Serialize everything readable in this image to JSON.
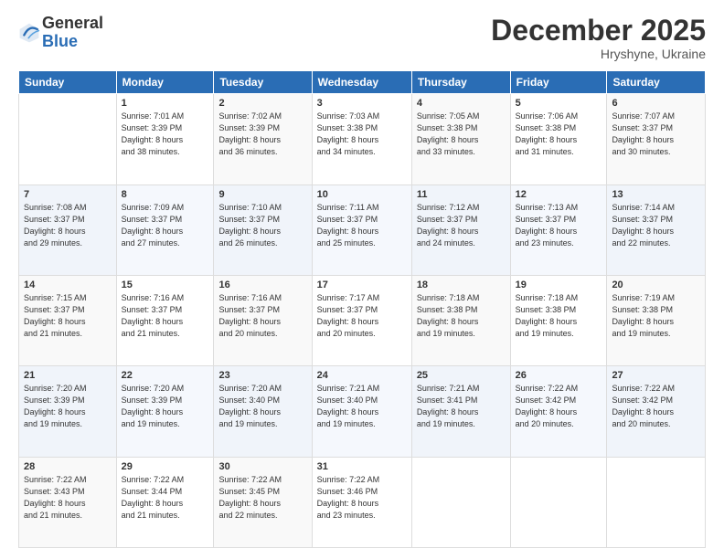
{
  "logo": {
    "general": "General",
    "blue": "Blue"
  },
  "title": {
    "month": "December 2025",
    "location": "Hryshyne, Ukraine"
  },
  "weekdays": [
    "Sunday",
    "Monday",
    "Tuesday",
    "Wednesday",
    "Thursday",
    "Friday",
    "Saturday"
  ],
  "weeks": [
    [
      {
        "day": "",
        "info": ""
      },
      {
        "day": "1",
        "info": "Sunrise: 7:01 AM\nSunset: 3:39 PM\nDaylight: 8 hours\nand 38 minutes."
      },
      {
        "day": "2",
        "info": "Sunrise: 7:02 AM\nSunset: 3:39 PM\nDaylight: 8 hours\nand 36 minutes."
      },
      {
        "day": "3",
        "info": "Sunrise: 7:03 AM\nSunset: 3:38 PM\nDaylight: 8 hours\nand 34 minutes."
      },
      {
        "day": "4",
        "info": "Sunrise: 7:05 AM\nSunset: 3:38 PM\nDaylight: 8 hours\nand 33 minutes."
      },
      {
        "day": "5",
        "info": "Sunrise: 7:06 AM\nSunset: 3:38 PM\nDaylight: 8 hours\nand 31 minutes."
      },
      {
        "day": "6",
        "info": "Sunrise: 7:07 AM\nSunset: 3:37 PM\nDaylight: 8 hours\nand 30 minutes."
      }
    ],
    [
      {
        "day": "7",
        "info": "Sunrise: 7:08 AM\nSunset: 3:37 PM\nDaylight: 8 hours\nand 29 minutes."
      },
      {
        "day": "8",
        "info": "Sunrise: 7:09 AM\nSunset: 3:37 PM\nDaylight: 8 hours\nand 27 minutes."
      },
      {
        "day": "9",
        "info": "Sunrise: 7:10 AM\nSunset: 3:37 PM\nDaylight: 8 hours\nand 26 minutes."
      },
      {
        "day": "10",
        "info": "Sunrise: 7:11 AM\nSunset: 3:37 PM\nDaylight: 8 hours\nand 25 minutes."
      },
      {
        "day": "11",
        "info": "Sunrise: 7:12 AM\nSunset: 3:37 PM\nDaylight: 8 hours\nand 24 minutes."
      },
      {
        "day": "12",
        "info": "Sunrise: 7:13 AM\nSunset: 3:37 PM\nDaylight: 8 hours\nand 23 minutes."
      },
      {
        "day": "13",
        "info": "Sunrise: 7:14 AM\nSunset: 3:37 PM\nDaylight: 8 hours\nand 22 minutes."
      }
    ],
    [
      {
        "day": "14",
        "info": "Sunrise: 7:15 AM\nSunset: 3:37 PM\nDaylight: 8 hours\nand 21 minutes."
      },
      {
        "day": "15",
        "info": "Sunrise: 7:16 AM\nSunset: 3:37 PM\nDaylight: 8 hours\nand 21 minutes."
      },
      {
        "day": "16",
        "info": "Sunrise: 7:16 AM\nSunset: 3:37 PM\nDaylight: 8 hours\nand 20 minutes."
      },
      {
        "day": "17",
        "info": "Sunrise: 7:17 AM\nSunset: 3:37 PM\nDaylight: 8 hours\nand 20 minutes."
      },
      {
        "day": "18",
        "info": "Sunrise: 7:18 AM\nSunset: 3:38 PM\nDaylight: 8 hours\nand 19 minutes."
      },
      {
        "day": "19",
        "info": "Sunrise: 7:18 AM\nSunset: 3:38 PM\nDaylight: 8 hours\nand 19 minutes."
      },
      {
        "day": "20",
        "info": "Sunrise: 7:19 AM\nSunset: 3:38 PM\nDaylight: 8 hours\nand 19 minutes."
      }
    ],
    [
      {
        "day": "21",
        "info": "Sunrise: 7:20 AM\nSunset: 3:39 PM\nDaylight: 8 hours\nand 19 minutes."
      },
      {
        "day": "22",
        "info": "Sunrise: 7:20 AM\nSunset: 3:39 PM\nDaylight: 8 hours\nand 19 minutes."
      },
      {
        "day": "23",
        "info": "Sunrise: 7:20 AM\nSunset: 3:40 PM\nDaylight: 8 hours\nand 19 minutes."
      },
      {
        "day": "24",
        "info": "Sunrise: 7:21 AM\nSunset: 3:40 PM\nDaylight: 8 hours\nand 19 minutes."
      },
      {
        "day": "25",
        "info": "Sunrise: 7:21 AM\nSunset: 3:41 PM\nDaylight: 8 hours\nand 19 minutes."
      },
      {
        "day": "26",
        "info": "Sunrise: 7:22 AM\nSunset: 3:42 PM\nDaylight: 8 hours\nand 20 minutes."
      },
      {
        "day": "27",
        "info": "Sunrise: 7:22 AM\nSunset: 3:42 PM\nDaylight: 8 hours\nand 20 minutes."
      }
    ],
    [
      {
        "day": "28",
        "info": "Sunrise: 7:22 AM\nSunset: 3:43 PM\nDaylight: 8 hours\nand 21 minutes."
      },
      {
        "day": "29",
        "info": "Sunrise: 7:22 AM\nSunset: 3:44 PM\nDaylight: 8 hours\nand 21 minutes."
      },
      {
        "day": "30",
        "info": "Sunrise: 7:22 AM\nSunset: 3:45 PM\nDaylight: 8 hours\nand 22 minutes."
      },
      {
        "day": "31",
        "info": "Sunrise: 7:22 AM\nSunset: 3:46 PM\nDaylight: 8 hours\nand 23 minutes."
      },
      {
        "day": "",
        "info": ""
      },
      {
        "day": "",
        "info": ""
      },
      {
        "day": "",
        "info": ""
      }
    ]
  ]
}
